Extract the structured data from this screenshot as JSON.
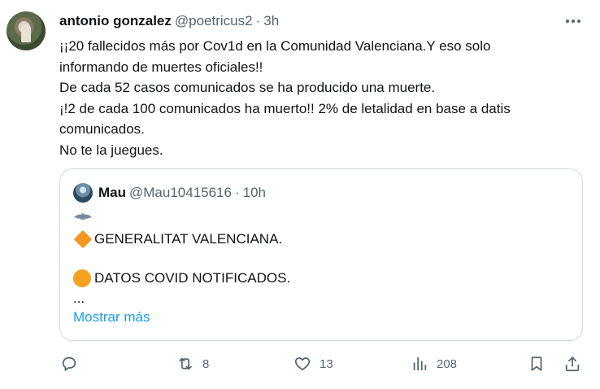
{
  "author": {
    "name": "antonio gonzalez",
    "handle": "@poetricus2",
    "separator": "·",
    "time": "3h"
  },
  "tweet_lines": [
    "¡¡20 fallecidos más por Cov1d en la Comunidad Valenciana.Y eso solo",
    "informando de muertes oficiales!!",
    "De cada 52 casos comunicados se ha producido una muerte.",
    "¡!2 de cada 100 comunicados ha muerto!! 2% de letalidad en base a datis",
    "comunicados.",
    "No te la juegues."
  ],
  "quoted": {
    "name": "Mau",
    "handle": "@Mau10415616",
    "separator": "·",
    "time": "10h",
    "icon_row": "bat-emoji",
    "line1": "GENERALITAT VALENCIANA.",
    "line2": "DATOS COVID NOTIFICADOS.",
    "ellipsis": "...",
    "show_more": "Mostrar más"
  },
  "actions": {
    "reply_count": "",
    "retweet_count": "8",
    "like_count": "13",
    "views_count": "208"
  },
  "colors": {
    "text": "#0f1419",
    "secondary": "#536471",
    "link": "#1d9bf0",
    "border": "#cfd9de",
    "orange": "#f49722"
  }
}
